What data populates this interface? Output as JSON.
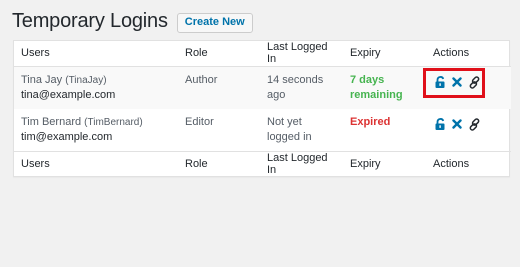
{
  "page": {
    "title": "Temporary Logins",
    "create_label": "Create New"
  },
  "table": {
    "columns": [
      "Users",
      "Role",
      "Last Logged In",
      "Expiry",
      "Actions"
    ],
    "rows": [
      {
        "name": "Tina Jay",
        "handle": "(TinaJay)",
        "email": "tina@example.com",
        "role": "Author",
        "last_logged_in": "14 seconds ago",
        "expiry": "7 days remaining",
        "expiry_status": "active",
        "actions": [
          "lock-icon",
          "delete-icon",
          "link-icon"
        ]
      },
      {
        "name": "Tim Bernard",
        "handle": "(TimBernard)",
        "email": "tim@example.com",
        "role": "Editor",
        "last_logged_in": "Not yet logged in",
        "expiry": "Expired",
        "expiry_status": "expired",
        "actions": [
          "lock-icon",
          "delete-icon",
          "link-icon"
        ]
      }
    ]
  },
  "colors": {
    "accent": "#0073aa",
    "active": "#46b450",
    "expired": "#dc3232",
    "highlight": "#e0101a"
  }
}
